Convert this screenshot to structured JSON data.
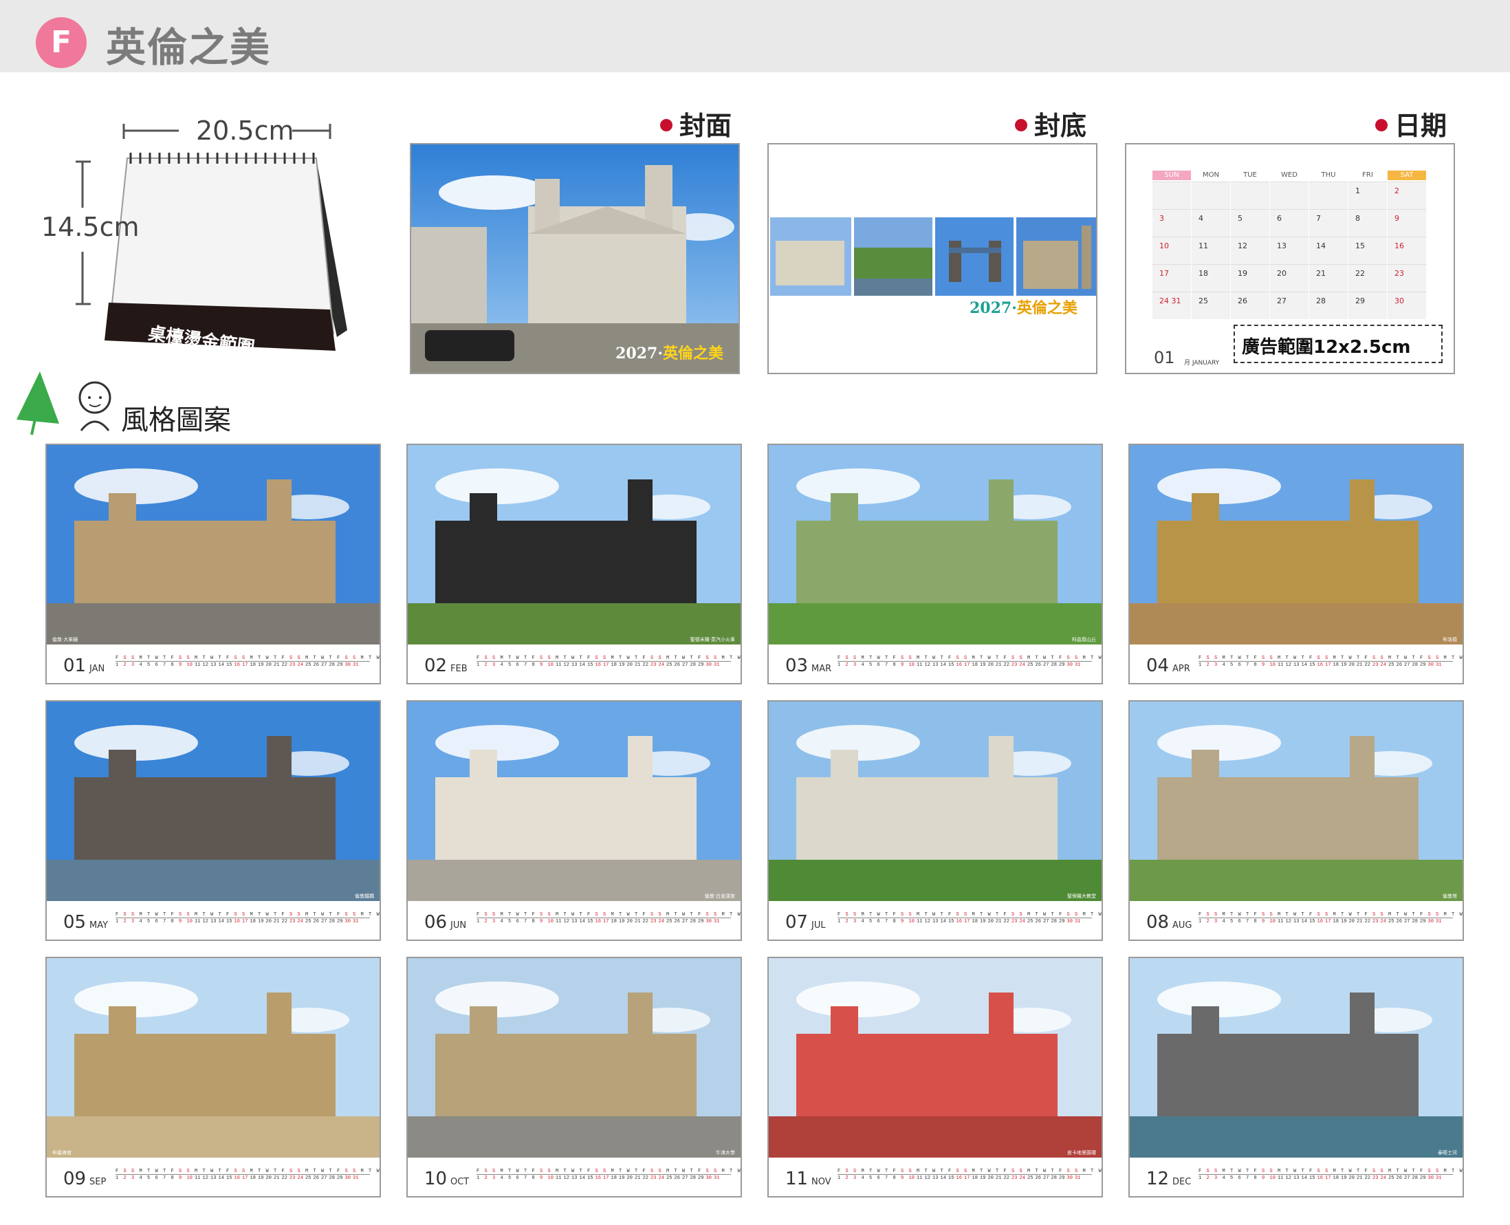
{
  "header": {
    "badge": "F",
    "title": "英倫之美"
  },
  "desk": {
    "width_label": "20.5cm",
    "height_label": "14.5cm",
    "hot_stamp_label": "桌檯燙金範圍"
  },
  "sections": {
    "cover": "封面",
    "back": "封底",
    "date": "日期",
    "style": "風格圖案"
  },
  "cover": {
    "year": "2027",
    "title": "英倫之美",
    "separator": "·"
  },
  "back": {
    "year": "2027",
    "title": "英倫之美",
    "separator": "·"
  },
  "date_page": {
    "weekdays": [
      "SUN",
      "MON",
      "TUE",
      "WED",
      "THU",
      "FRI",
      "SAT"
    ],
    "weeks": [
      [
        "",
        "",
        "",
        "",
        "",
        "1",
        "2"
      ],
      [
        "3",
        "4",
        "5",
        "6",
        "7",
        "8",
        "9"
      ],
      [
        "10",
        "11",
        "12",
        "13",
        "14",
        "15",
        "16"
      ],
      [
        "17",
        "18",
        "19",
        "20",
        "21",
        "22",
        "23"
      ],
      [
        "24 31",
        "25",
        "26",
        "27",
        "28",
        "29",
        "30"
      ]
    ],
    "ad_label": "廣告範圍12x2.5cm",
    "month_num": "01",
    "month_sub": "月 JANUARY"
  },
  "months": [
    {
      "num": "01",
      "abbr": "JAN",
      "caption": "倫敦·大笨鐘"
    },
    {
      "num": "02",
      "abbr": "FEB",
      "caption": "聖德米爾·蒸汽小火車"
    },
    {
      "num": "03",
      "abbr": "MAR",
      "caption": "科茲窩山丘"
    },
    {
      "num": "04",
      "abbr": "APR",
      "caption": "布洛德"
    },
    {
      "num": "05",
      "abbr": "MAY",
      "caption": "倫敦鐵橋"
    },
    {
      "num": "06",
      "abbr": "JUN",
      "caption": "倫敦·白金漢宮"
    },
    {
      "num": "07",
      "abbr": "JUL",
      "caption": "聖保羅大教堂"
    },
    {
      "num": "08",
      "abbr": "AUG",
      "caption": "倫敦塔"
    },
    {
      "num": "09",
      "abbr": "SEP",
      "caption": "布倫海宮"
    },
    {
      "num": "10",
      "abbr": "OCT",
      "caption": "牛津大學"
    },
    {
      "num": "11",
      "abbr": "NOV",
      "caption": "皮卡地里圓環"
    },
    {
      "num": "12",
      "abbr": "DEC",
      "caption": "泰晤士河"
    }
  ],
  "strip_letters": "F S S M T W T F S S M T W T F S S M T W T F S S M T W T F S S M T W",
  "strip_numbers": "1 2 3 4 5 6 7 8 9 10 11 12 13 14 15 16 17 18 19 20 21 22 23 24 25 26 27 28 29 30 31",
  "colors": {
    "badge": "#f0789a",
    "accent_red": "#c8102e",
    "sky": "#4a90d9",
    "grass": "#5a9a3c"
  }
}
